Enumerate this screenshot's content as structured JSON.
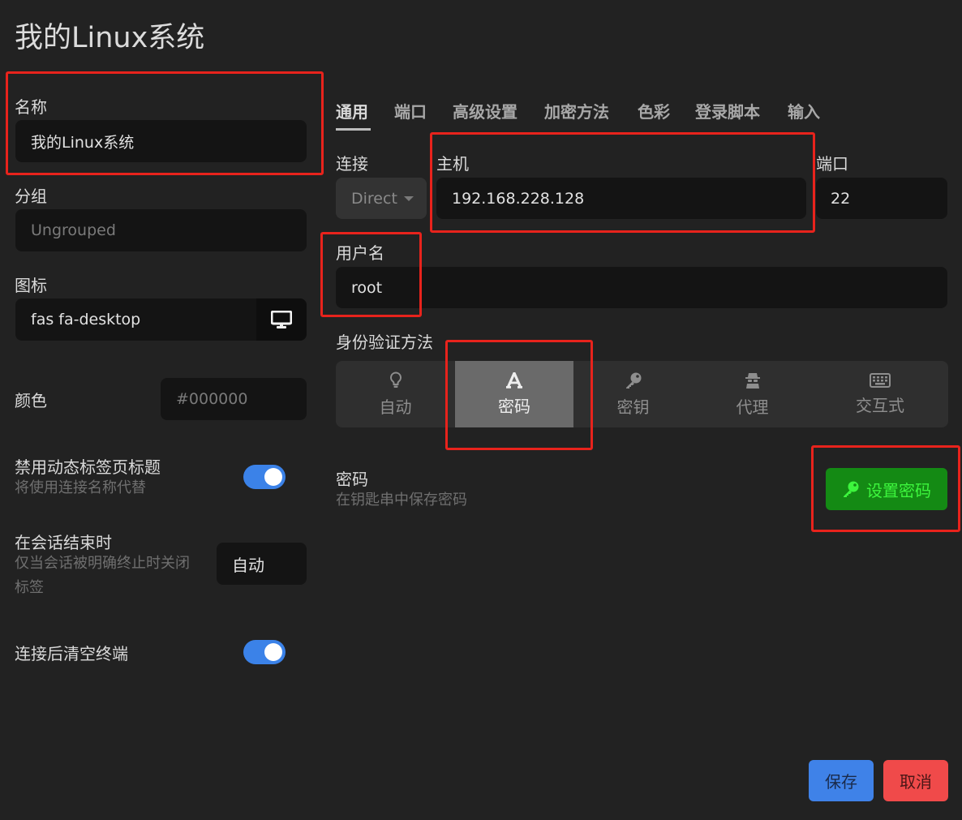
{
  "page": {
    "title": "我的Linux系统"
  },
  "left": {
    "name": {
      "label": "名称",
      "value": "我的Linux系统"
    },
    "group": {
      "label": "分组",
      "placeholder": "Ungrouped"
    },
    "icon": {
      "label": "图标",
      "value": "fas fa-desktop",
      "button_icon": "desktop-icon"
    },
    "color": {
      "label": "颜色",
      "placeholder": "#000000"
    },
    "disable_dynamic_title": {
      "label": "禁用动态标签页标题",
      "sublabel": "将使用连接名称代替",
      "on": true
    },
    "on_session_end": {
      "label": "在会话结束时",
      "sublabel_line1": "仅当会话被明确终止时关闭",
      "sublabel_line2": "标签",
      "value": "自动"
    },
    "clear_terminal": {
      "label": "连接后清空终端",
      "on": true
    }
  },
  "tabs": [
    "通用",
    "端口",
    "高级设置",
    "加密方法",
    "色彩",
    "登录脚本",
    "输入"
  ],
  "active_tab": 0,
  "connection": {
    "label": "连接",
    "type": "Direct",
    "host_label": "主机",
    "host": "192.168.228.128",
    "port_label": "端口",
    "port": "22"
  },
  "username": {
    "label": "用户名",
    "value": "root"
  },
  "auth": {
    "label": "身份验证方法",
    "options": [
      {
        "label": "自动",
        "icon": "lightbulb-icon"
      },
      {
        "label": "密码",
        "icon": "font-a-icon"
      },
      {
        "label": "密钥",
        "icon": "key-icon"
      },
      {
        "label": "代理",
        "icon": "user-secret-icon"
      },
      {
        "label": "交互式",
        "icon": "keyboard-icon"
      }
    ],
    "active": 1
  },
  "password": {
    "label": "密码",
    "sublabel": "在钥匙串中保存密码",
    "button": "设置密码",
    "button_icon": "key-icon"
  },
  "footer": {
    "save": "保存",
    "cancel": "取消"
  },
  "colors": {
    "save": "#3f82e8",
    "cancel": "#f04a4a",
    "set_password": "#148a14",
    "highlight": "#e8231c",
    "toggle": "#3b82e8"
  }
}
